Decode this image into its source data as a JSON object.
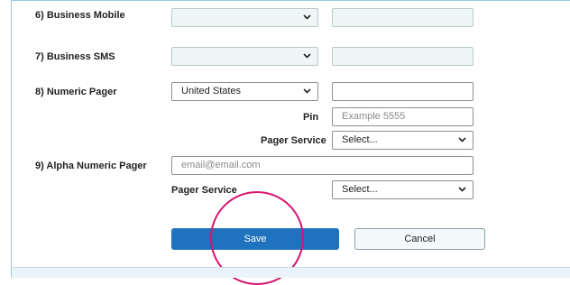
{
  "rows": {
    "business_mobile": {
      "label": "6) Business Mobile"
    },
    "business_sms": {
      "label": "7) Business SMS"
    },
    "numeric_pager": {
      "label": "8) Numeric Pager",
      "country": "United States",
      "pin_label": "Pin",
      "pin_placeholder": "Example 5555",
      "service_label": "Pager Service",
      "service_value": "Select..."
    },
    "alpha_pager": {
      "label": "9) Alpha Numeric Pager",
      "email_placeholder": "email@email.com",
      "service_label": "Pager Service",
      "service_value": "Select..."
    }
  },
  "buttons": {
    "save": "Save",
    "cancel": "Cancel"
  },
  "colors": {
    "primary": "#1f72bd",
    "highlight_circle": "#d4166e"
  },
  "icons": {
    "dropdown": "chevron-down-icon"
  }
}
